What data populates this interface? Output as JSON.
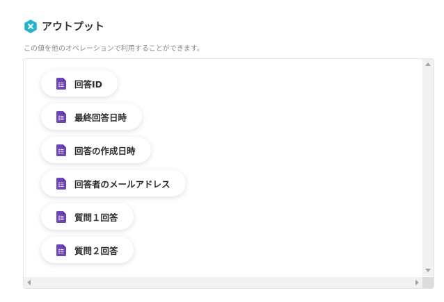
{
  "header": {
    "icon": "variable-x-icon",
    "icon_color": "#1fb6d6",
    "title": "アウトプット",
    "description": "この値を他のオペレーションで利用することができます。"
  },
  "outputs": {
    "item_icon": "google-forms-icon",
    "item_icon_color": "#6f42c1",
    "items": [
      {
        "label": "回答ID"
      },
      {
        "label": "最終回答日時"
      },
      {
        "label": "回答の作成日時"
      },
      {
        "label": "回答者のメールアドレス"
      },
      {
        "label": "質問１回答"
      },
      {
        "label": "質問２回答"
      }
    ]
  }
}
